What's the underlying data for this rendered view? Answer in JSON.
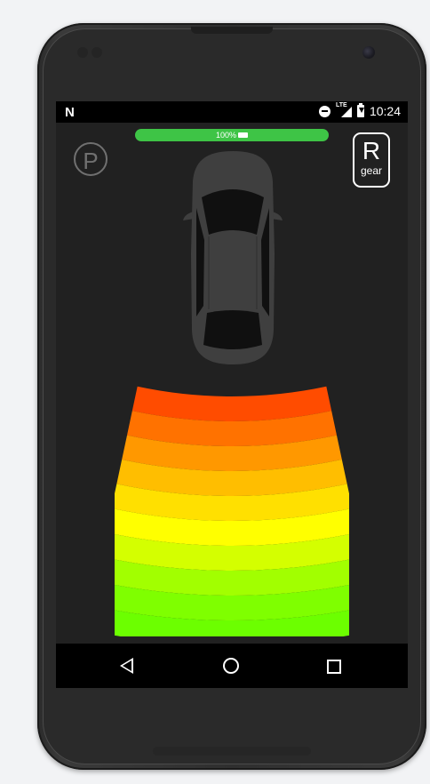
{
  "status_bar": {
    "notification_glyph": "N",
    "time": "10:24",
    "network_label": "LTE",
    "icons": [
      "n-notification-icon",
      "do-not-disturb-icon",
      "lte-signal-icon",
      "battery-charging-icon"
    ]
  },
  "battery_indicator": {
    "label": "100%",
    "level_percent": 100,
    "icon": "battery-charging-icon",
    "color": "#3ec446"
  },
  "parking_indicator": {
    "label": "P",
    "color": "#707070"
  },
  "gear_indicator": {
    "letter": "R",
    "caption": "gear"
  },
  "parking_sensor": {
    "zones": [
      {
        "color": "#ff4c00"
      },
      {
        "color": "#ff7200"
      },
      {
        "color": "#ff9800"
      },
      {
        "color": "#ffbe00"
      },
      {
        "color": "#ffe000"
      },
      {
        "color": "#ffff00"
      },
      {
        "color": "#d4ff00"
      },
      {
        "color": "#a2ff00"
      },
      {
        "color": "#7fff00"
      },
      {
        "color": "#6cff00"
      }
    ]
  },
  "nav_bar": {
    "icons": [
      "back-icon",
      "home-icon",
      "recent-apps-icon"
    ]
  },
  "colors": {
    "screen_background": "#212121",
    "car_body": "#3f3f3f",
    "car_glass": "#101010"
  }
}
